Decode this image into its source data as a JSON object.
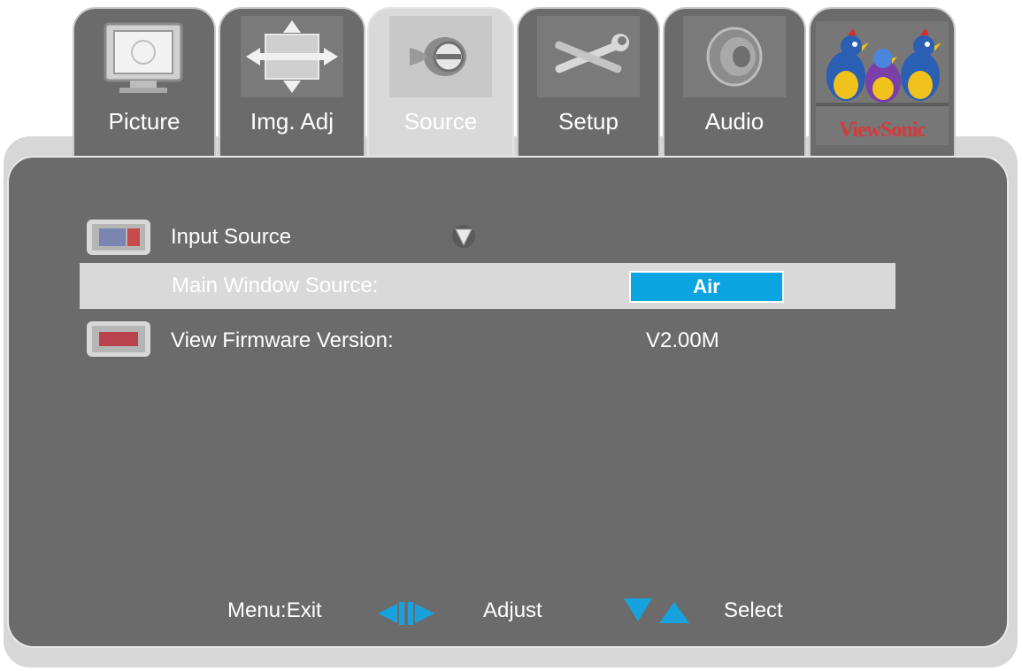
{
  "tabs": [
    {
      "label": "Picture",
      "icon": "tv-icon",
      "active": false
    },
    {
      "label": "Img. Adj",
      "icon": "image-adjust-icon",
      "active": false
    },
    {
      "label": "Source",
      "icon": "source-connector-icon",
      "active": true
    },
    {
      "label": "Setup",
      "icon": "tools-icon",
      "active": false
    },
    {
      "label": "Audio",
      "icon": "speaker-icon",
      "active": false
    }
  ],
  "brand": {
    "name": "ViewSonic",
    "logo": "viewsonic-birds-logo"
  },
  "menu": {
    "input_source": {
      "label": "Input Source",
      "icon": "input-source-icon",
      "dropdown_icon": "triangle-down-icon"
    },
    "main_window_source": {
      "label": "Main Window Source:",
      "value": "Air"
    },
    "firmware": {
      "label": "View Firmware Version:",
      "value": "V2.00M",
      "icon": "firmware-icon"
    }
  },
  "footer": {
    "exit_label": "Menu:Exit",
    "adjust_label": "Adjust",
    "select_label": "Select",
    "adjust_icon": "left-right-arrows-icon",
    "select_icon": "up-down-arrows-icon"
  },
  "colors": {
    "panel": "#6b6b6b",
    "highlight": "#d9d9d9",
    "accent": "#0aa4e0"
  }
}
